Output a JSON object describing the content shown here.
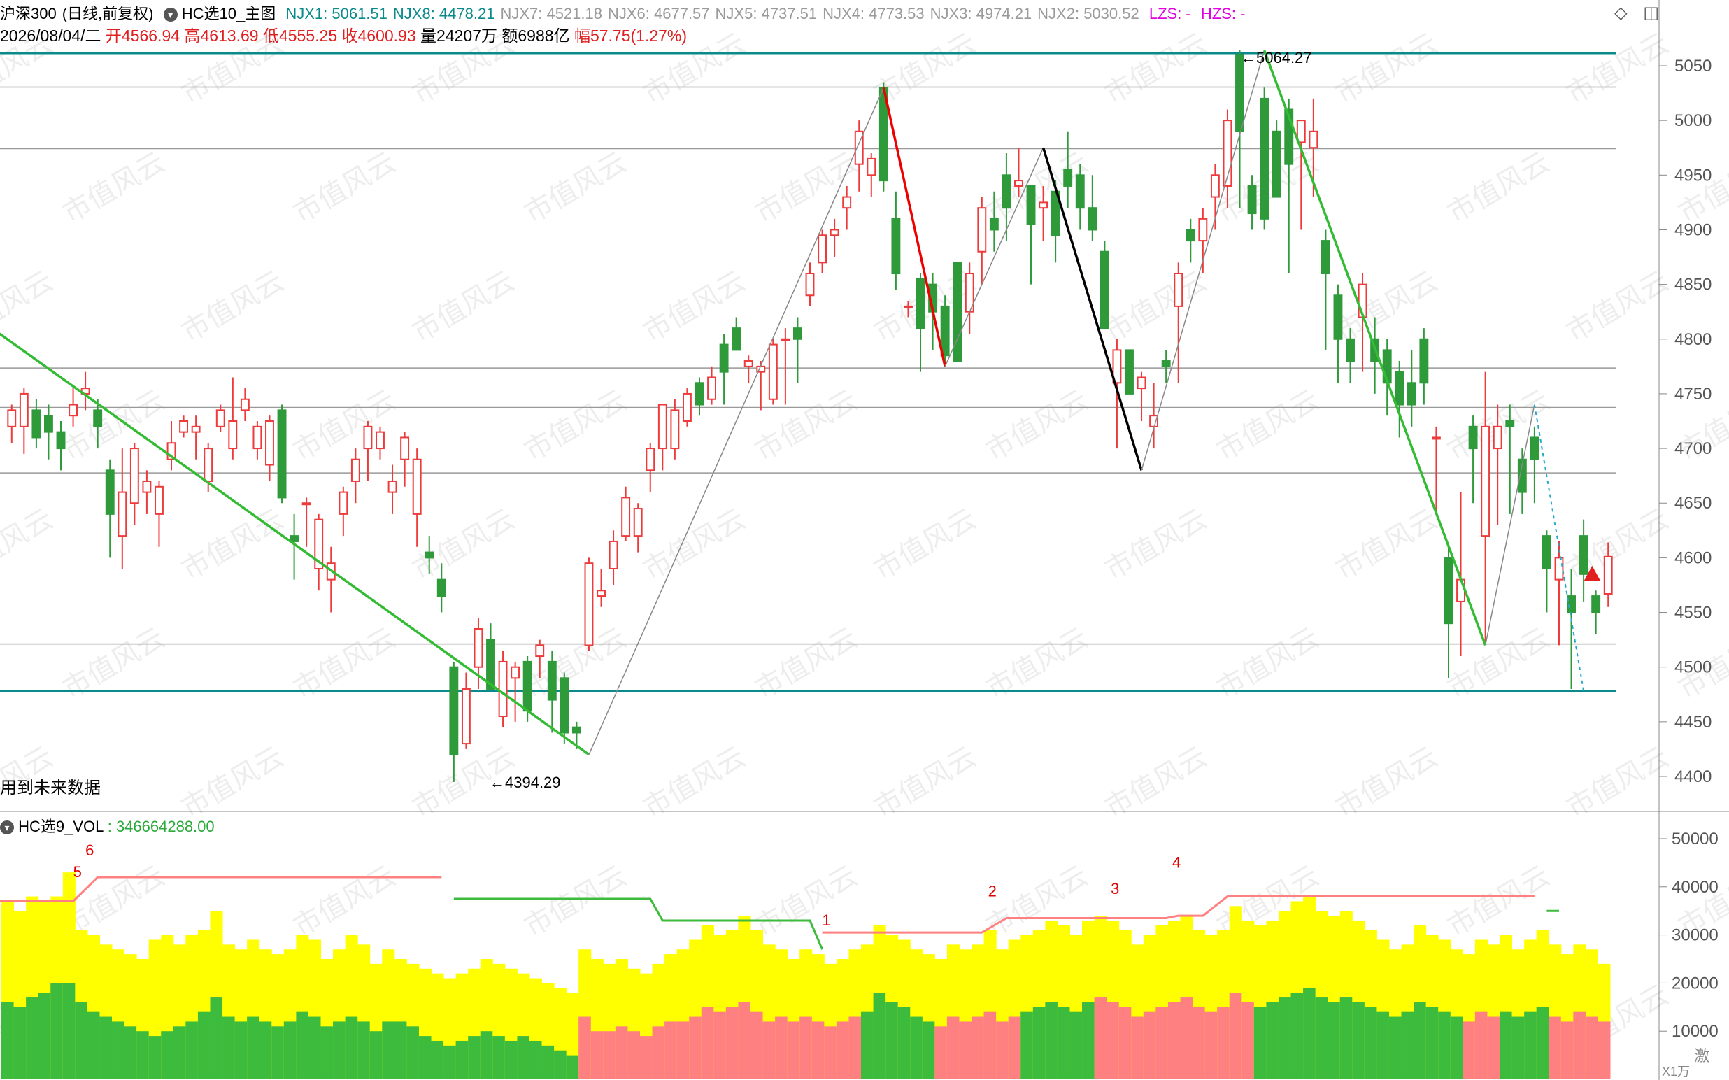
{
  "header": {
    "index_name": "沪深300",
    "period": "(日线,前复权)",
    "indicator": "HC选10_主图",
    "njx": [
      {
        "label": "NJX1:",
        "value": "5061.51",
        "color": "#0a8a8a"
      },
      {
        "label": "NJX8:",
        "value": "4478.21",
        "color": "#0a8a8a"
      },
      {
        "label": "NJX7:",
        "value": "4521.18",
        "color": "#9a9a9a"
      },
      {
        "label": "NJX6:",
        "value": "4677.57",
        "color": "#9a9a9a"
      },
      {
        "label": "NJX5:",
        "value": "4737.51",
        "color": "#9a9a9a"
      },
      {
        "label": "NJX4:",
        "value": "4773.53",
        "color": "#9a9a9a"
      },
      {
        "label": "NJX3:",
        "value": "4974.21",
        "color": "#9a9a9a"
      },
      {
        "label": "NJX2:",
        "value": "5030.52",
        "color": "#9a9a9a"
      }
    ],
    "lzs": "LZS: -",
    "hzs": "HZS: -",
    "date": "2026/08/04/二",
    "open_label": "开",
    "open": "4566.94",
    "high_label": "高",
    "high": "4613.69",
    "low_label": "低",
    "low": "4555.25",
    "close_label": "收",
    "close": "4600.93",
    "vol_label": "量",
    "vol": "24207万",
    "amount_label": "额",
    "amount": "6988亿",
    "change_label": "幅",
    "change": "57.75(1.27%)"
  },
  "window_icons": [
    "diamond-icon",
    "panel-toggle-icon"
  ],
  "note": "用到未来数据",
  "high_marker": "5064.27",
  "low_marker": "4394.29",
  "volume_panel": {
    "title": "HC选9_VOL",
    "value": "346664288.00",
    "wave_labels": [
      "6",
      "5",
      "1",
      "2",
      "3",
      "4"
    ],
    "unit": "X1万",
    "corner_text": "激"
  },
  "watermark": "市值风云",
  "chart_data": {
    "type": "candlestick",
    "price_axis": {
      "ticks": [
        4400,
        4450,
        4500,
        4550,
        4600,
        4650,
        4700,
        4750,
        4800,
        4850,
        4900,
        4950,
        5000,
        5050
      ],
      "ylim": [
        4375,
        5070
      ]
    },
    "volume_axis": {
      "ticks": [
        10000,
        20000,
        30000,
        40000,
        50000
      ],
      "ylim": [
        0,
        52000
      ]
    },
    "support_lines": [
      5061.51,
      4478.21,
      4521.18,
      4677.57,
      4737.51,
      4773.53,
      4974.21,
      5030.52
    ],
    "candles": [
      [
        4720,
        4735,
        4705,
        4740
      ],
      [
        4720,
        4750,
        4695,
        4755
      ],
      [
        4735,
        4710,
        4700,
        4745
      ],
      [
        4730,
        4715,
        4690,
        4740
      ],
      [
        4715,
        4700,
        4680,
        4725
      ],
      [
        4730,
        4740,
        4720,
        4755
      ],
      [
        4750,
        4755,
        4735,
        4770
      ],
      [
        4735,
        4720,
        4700,
        4745
      ],
      [
        4680,
        4640,
        4600,
        4690
      ],
      [
        4620,
        4660,
        4590,
        4700
      ],
      [
        4650,
        4700,
        4630,
        4705
      ],
      [
        4660,
        4670,
        4640,
        4680
      ],
      [
        4640,
        4665,
        4610,
        4670
      ],
      [
        4690,
        4705,
        4680,
        4725
      ],
      [
        4715,
        4725,
        4710,
        4730
      ],
      [
        4715,
        4720,
        4690,
        4730
      ],
      [
        4670,
        4700,
        4660,
        4705
      ],
      [
        4720,
        4735,
        4715,
        4740
      ],
      [
        4700,
        4725,
        4690,
        4765
      ],
      [
        4735,
        4745,
        4725,
        4755
      ],
      [
        4700,
        4720,
        4690,
        4725
      ],
      [
        4685,
        4725,
        4670,
        4730
      ],
      [
        4735,
        4655,
        4650,
        4740
      ],
      [
        4620,
        4615,
        4580,
        4640
      ],
      [
        4650,
        4650,
        4610,
        4655
      ],
      [
        4590,
        4635,
        4570,
        4640
      ],
      [
        4580,
        4595,
        4550,
        4610
      ],
      [
        4640,
        4660,
        4620,
        4665
      ],
      [
        4670,
        4690,
        4650,
        4700
      ],
      [
        4700,
        4720,
        4670,
        4725
      ],
      [
        4700,
        4715,
        4690,
        4720
      ],
      [
        4660,
        4670,
        4640,
        4685
      ],
      [
        4690,
        4710,
        4665,
        4715
      ],
      [
        4640,
        4690,
        4610,
        4700
      ],
      [
        4605,
        4600,
        4585,
        4620
      ],
      [
        4580,
        4565,
        4550,
        4595
      ],
      [
        4500,
        4420,
        4395,
        4505
      ],
      [
        4430,
        4480,
        4425,
        4495
      ],
      [
        4500,
        4535,
        4480,
        4545
      ],
      [
        4525,
        4480,
        4480,
        4540
      ],
      [
        4455,
        4505,
        4445,
        4515
      ],
      [
        4490,
        4500,
        4450,
        4505
      ],
      [
        4505,
        4460,
        4450,
        4510
      ],
      [
        4510,
        4520,
        4490,
        4525
      ],
      [
        4505,
        4470,
        4440,
        4515
      ],
      [
        4490,
        4440,
        4430,
        4495
      ],
      [
        4445,
        4440,
        4425,
        4450
      ],
      [
        4520,
        4595,
        4515,
        4600
      ],
      [
        4565,
        4570,
        4555,
        4590
      ],
      [
        4590,
        4615,
        4575,
        4625
      ],
      [
        4620,
        4655,
        4615,
        4665
      ],
      [
        4620,
        4645,
        4605,
        4650
      ],
      [
        4680,
        4700,
        4660,
        4705
      ],
      [
        4700,
        4740,
        4680,
        4740
      ],
      [
        4700,
        4735,
        4690,
        4745
      ],
      [
        4725,
        4750,
        4720,
        4755
      ],
      [
        4760,
        4740,
        4730,
        4765
      ],
      [
        4745,
        4765,
        4740,
        4775
      ],
      [
        4795,
        4770,
        4740,
        4805
      ],
      [
        4810,
        4790,
        4790,
        4820
      ],
      [
        4775,
        4780,
        4760,
        4785
      ],
      [
        4770,
        4775,
        4735,
        4780
      ],
      [
        4745,
        4795,
        4740,
        4800
      ],
      [
        4800,
        4800,
        4740,
        4810
      ],
      [
        4810,
        4800,
        4760,
        4820
      ],
      [
        4840,
        4860,
        4830,
        4870
      ],
      [
        4870,
        4895,
        4860,
        4900
      ],
      [
        4895,
        4900,
        4875,
        4910
      ],
      [
        4920,
        4930,
        4900,
        4940
      ],
      [
        4960,
        4990,
        4935,
        5000
      ],
      [
        4950,
        4965,
        4930,
        4970
      ],
      [
        5030,
        4945,
        4935,
        5035
      ],
      [
        4910,
        4860,
        4845,
        4935
      ],
      [
        4830,
        4830,
        4820,
        4835
      ],
      [
        4855,
        4810,
        4770,
        4860
      ],
      [
        4850,
        4825,
        4790,
        4860
      ],
      [
        4830,
        4785,
        4775,
        4840
      ],
      [
        4870,
        4780,
        4780,
        4870
      ],
      [
        4825,
        4860,
        4805,
        4870
      ],
      [
        4880,
        4920,
        4850,
        4930
      ],
      [
        4910,
        4900,
        4880,
        4935
      ],
      [
        4950,
        4920,
        4890,
        4970
      ],
      [
        4940,
        4945,
        4930,
        4975
      ],
      [
        4940,
        4905,
        4850,
        4940
      ],
      [
        4920,
        4925,
        4890,
        4940
      ],
      [
        4935,
        4895,
        4870,
        4945
      ],
      [
        4955,
        4940,
        4920,
        4990
      ],
      [
        4950,
        4920,
        4900,
        4960
      ],
      [
        4920,
        4900,
        4890,
        4950
      ],
      [
        4880,
        4810,
        4810,
        4890
      ],
      [
        4760,
        4790,
        4700,
        4800
      ],
      [
        4790,
        4750,
        4760,
        4790
      ],
      [
        4755,
        4765,
        4725,
        4770
      ],
      [
        4720,
        4730,
        4700,
        4760
      ],
      [
        4780,
        4775,
        4760,
        4790
      ],
      [
        4830,
        4860,
        4760,
        4870
      ],
      [
        4900,
        4890,
        4870,
        4910
      ],
      [
        4890,
        4910,
        4860,
        4920
      ],
      [
        4930,
        4950,
        4900,
        4960
      ],
      [
        4940,
        5000,
        4920,
        5010
      ],
      [
        5060,
        4990,
        4920,
        5064
      ],
      [
        4940,
        4915,
        4900,
        4950
      ],
      [
        5020,
        4910,
        4900,
        5030
      ],
      [
        4990,
        4930,
        4950,
        5000
      ],
      [
        5010,
        4960,
        4860,
        5020
      ],
      [
        4980,
        5000,
        4900,
        4990
      ],
      [
        4975,
        4990,
        4930,
        5020
      ],
      [
        4890,
        4860,
        4790,
        4900
      ],
      [
        4840,
        4800,
        4760,
        4850
      ],
      [
        4800,
        4780,
        4760,
        4810
      ],
      [
        4820,
        4850,
        4770,
        4860
      ],
      [
        4800,
        4780,
        4750,
        4820
      ],
      [
        4790,
        4760,
        4730,
        4800
      ],
      [
        4770,
        4740,
        4710,
        4780
      ],
      [
        4760,
        4740,
        4720,
        4790
      ],
      [
        4800,
        4760,
        4740,
        4810
      ],
      [
        4710,
        4710,
        4640,
        4720
      ],
      [
        4600,
        4540,
        4490,
        4610
      ],
      [
        4560,
        4580,
        4510,
        4660
      ],
      [
        4720,
        4700,
        4650,
        4730
      ],
      [
        4620,
        4720,
        4520,
        4770
      ],
      [
        4700,
        4720,
        4630,
        4740
      ],
      [
        4725,
        4720,
        4640,
        4740
      ],
      [
        4690,
        4660,
        4640,
        4700
      ],
      [
        4710,
        4690,
        4650,
        4720
      ],
      [
        4620,
        4590,
        4550,
        4625
      ],
      [
        4580,
        4600,
        4520,
        4615
      ],
      [
        4565,
        4550,
        4480,
        4590
      ],
      [
        4620,
        4585,
        4560,
        4635
      ],
      [
        4565,
        4550,
        4530,
        4570
      ],
      [
        4567,
        4601,
        4555,
        4614
      ]
    ],
    "volumes": [
      [
        16000,
        37000
      ],
      [
        15000,
        35000
      ],
      [
        17000,
        38000
      ],
      [
        18000,
        37000
      ],
      [
        20000,
        38000
      ],
      [
        20000,
        43000
      ],
      [
        16000,
        31000
      ],
      [
        14000,
        30000
      ],
      [
        13000,
        28000
      ],
      [
        12000,
        27000
      ],
      [
        11000,
        26000
      ],
      [
        10000,
        25000
      ],
      [
        9000,
        29000
      ],
      [
        10000,
        30000
      ],
      [
        11000,
        28000
      ],
      [
        12000,
        30000
      ],
      [
        14000,
        31000
      ],
      [
        17000,
        35000
      ],
      [
        13000,
        28000
      ],
      [
        12000,
        27000
      ],
      [
        13000,
        29000
      ],
      [
        12000,
        27000
      ],
      [
        11000,
        26000
      ],
      [
        12000,
        27000
      ],
      [
        14000,
        30000
      ],
      [
        13000,
        29000
      ],
      [
        11000,
        25000
      ],
      [
        12000,
        27000
      ],
      [
        13000,
        30000
      ],
      [
        12000,
        28000
      ],
      [
        10000,
        24000
      ],
      [
        12000,
        27000
      ],
      [
        12000,
        25000
      ],
      [
        11000,
        24000
      ],
      [
        9000,
        23000
      ],
      [
        8000,
        22000
      ],
      [
        7000,
        21000
      ],
      [
        8000,
        22000
      ],
      [
        9000,
        23000
      ],
      [
        10000,
        25000
      ],
      [
        9000,
        24000
      ],
      [
        8000,
        23000
      ],
      [
        9000,
        22000
      ],
      [
        8000,
        21000
      ],
      [
        7000,
        20000
      ],
      [
        6000,
        19000
      ],
      [
        5000,
        18000
      ],
      [
        13000,
        27000
      ],
      [
        10000,
        25000
      ],
      [
        10000,
        24000
      ],
      [
        11000,
        25000
      ],
      [
        10000,
        23000
      ],
      [
        9000,
        22000
      ],
      [
        11000,
        24000
      ],
      [
        12000,
        26000
      ],
      [
        12000,
        27000
      ],
      [
        13000,
        29000
      ],
      [
        15000,
        32000
      ],
      [
        14000,
        30000
      ],
      [
        15000,
        31000
      ],
      [
        16000,
        34000
      ],
      [
        14000,
        31000
      ],
      [
        12000,
        28000
      ],
      [
        13000,
        27000
      ],
      [
        12000,
        25000
      ],
      [
        13000,
        27000
      ],
      [
        12000,
        26000
      ],
      [
        11000,
        24000
      ],
      [
        12000,
        25000
      ],
      [
        13000,
        27000
      ],
      [
        14000,
        28000
      ],
      [
        18000,
        32000
      ],
      [
        16000,
        30000
      ],
      [
        15000,
        29000
      ],
      [
        13000,
        27000
      ],
      [
        12000,
        26000
      ],
      [
        11000,
        25000
      ],
      [
        13000,
        28000
      ],
      [
        12000,
        27000
      ],
      [
        13000,
        28000
      ],
      [
        14000,
        31000
      ],
      [
        12000,
        27000
      ],
      [
        13000,
        29000
      ],
      [
        14000,
        30000
      ],
      [
        15000,
        31000
      ],
      [
        16000,
        33000
      ],
      [
        15000,
        32000
      ],
      [
        14000,
        30000
      ],
      [
        16000,
        33000
      ],
      [
        17000,
        34000
      ],
      [
        16000,
        33000
      ],
      [
        15000,
        31000
      ],
      [
        13000,
        28000
      ],
      [
        14000,
        30000
      ],
      [
        15000,
        32000
      ],
      [
        16000,
        33000
      ],
      [
        17000,
        34000
      ],
      [
        15000,
        31000
      ],
      [
        14000,
        30000
      ],
      [
        15000,
        31000
      ],
      [
        18000,
        36000
      ],
      [
        16000,
        33000
      ],
      [
        15000,
        32000
      ],
      [
        16000,
        33000
      ],
      [
        17000,
        35000
      ],
      [
        18000,
        37000
      ],
      [
        19000,
        38000
      ],
      [
        17000,
        35000
      ],
      [
        16000,
        34000
      ],
      [
        17000,
        35000
      ],
      [
        16000,
        33000
      ],
      [
        15000,
        31000
      ],
      [
        14000,
        29000
      ],
      [
        13000,
        27000
      ],
      [
        14000,
        28000
      ],
      [
        16000,
        32000
      ],
      [
        15000,
        30000
      ],
      [
        14000,
        29000
      ],
      [
        13000,
        27000
      ],
      [
        12000,
        26000
      ],
      [
        14000,
        29000
      ],
      [
        13000,
        28000
      ],
      [
        14000,
        30000
      ],
      [
        13000,
        27000
      ],
      [
        14000,
        29000
      ],
      [
        15000,
        31000
      ],
      [
        13000,
        28000
      ],
      [
        12000,
        26000
      ],
      [
        14000,
        28000
      ],
      [
        13000,
        27000
      ],
      [
        12000,
        24000
      ]
    ],
    "trend_lines": [
      {
        "color": "#33bb33",
        "points": [
          [
            -1,
            4805
          ],
          [
            47,
            4420
          ]
        ]
      },
      {
        "color": "#888888",
        "points": [
          [
            47,
            4420
          ],
          [
            71,
            5030
          ]
        ]
      },
      {
        "color": "#ee0000",
        "points": [
          [
            71,
            5030
          ],
          [
            76,
            4775
          ]
        ]
      },
      {
        "color": "#888888",
        "points": [
          [
            76,
            4775
          ],
          [
            84,
            4975
          ]
        ]
      },
      {
        "color": "#000000",
        "points": [
          [
            84,
            4975
          ],
          [
            92,
            4680
          ]
        ]
      },
      {
        "color": "#888888",
        "points": [
          [
            92,
            4680
          ],
          [
            102,
            5064
          ]
        ]
      },
      {
        "color": "#33bb33",
        "points": [
          [
            102,
            5064
          ],
          [
            120,
            4520
          ]
        ]
      },
      {
        "color": "#888888",
        "points": [
          [
            120,
            4520
          ],
          [
            124,
            4740
          ]
        ]
      }
    ]
  }
}
